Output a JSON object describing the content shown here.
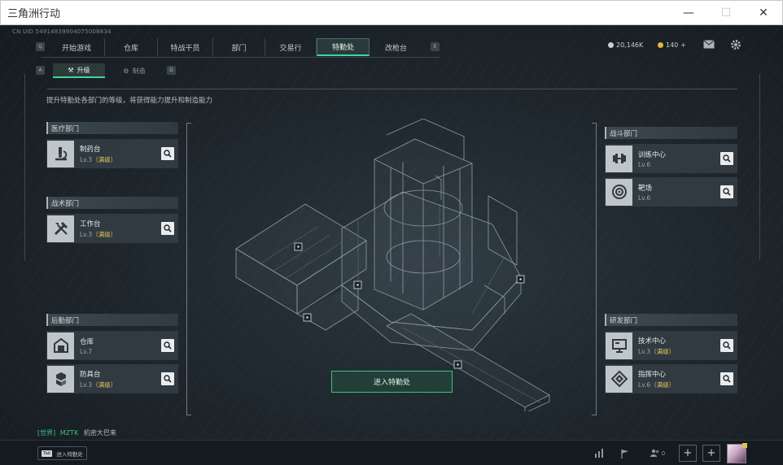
{
  "window": {
    "title": "三角洲行动"
  },
  "uid": "CN UID 549148399040750088​34",
  "nav": {
    "prev_key": "Q",
    "next_key": "E",
    "tabs": [
      {
        "label": "开始游戏"
      },
      {
        "label": "仓库"
      },
      {
        "label": "特战干员"
      },
      {
        "label": "部门"
      },
      {
        "label": "交易行"
      },
      {
        "label": "特勤处",
        "active": true
      },
      {
        "label": "改枪台"
      }
    ]
  },
  "resources": {
    "currency": "20,146K",
    "coupons": "140",
    "coupons_plus": "+"
  },
  "subtabs": {
    "prev_key": "A",
    "next_key": "D",
    "items": [
      {
        "label": "升级",
        "active": true
      },
      {
        "label": "制造"
      }
    ]
  },
  "description": "提升特勤处各部门的等级，将获得能力提升和制造能力",
  "departments": {
    "medical": {
      "title": "医疗部门",
      "items": [
        {
          "name": "制药台",
          "level": "Lv.3",
          "max": "（满级）",
          "icon": "microscope-icon"
        }
      ]
    },
    "tactical": {
      "title": "战术部门",
      "items": [
        {
          "name": "工作台",
          "level": "Lv.3",
          "max": "（满级）",
          "icon": "tools-icon"
        }
      ]
    },
    "logistics": {
      "title": "后勤部门",
      "items": [
        {
          "name": "仓库",
          "level": "Lv.7",
          "icon": "storage-icon"
        },
        {
          "name": "防具台",
          "level": "Lv.3",
          "max": "（满级）",
          "icon": "armor-icon"
        }
      ]
    },
    "combat": {
      "title": "战斗部门",
      "items": [
        {
          "name": "训练中心",
          "level": "Lv.6",
          "icon": "dumbbell-icon"
        },
        {
          "name": "靶场",
          "level": "Lv.6",
          "icon": "target-icon"
        }
      ]
    },
    "research": {
      "title": "研发部门",
      "items": [
        {
          "name": "技术中心",
          "level": "Lv.3",
          "max": "（满级）",
          "icon": "monitor-icon"
        },
        {
          "name": "指挥中心",
          "level": "Lv.6",
          "max": "（满级）",
          "icon": "command-icon"
        }
      ]
    }
  },
  "enter_button": "进入特勤处",
  "chat": {
    "channel": "[世界]",
    "sender": "MZTK",
    "message": "机密大巴来"
  },
  "bottom": {
    "tab_key": "Tab",
    "tab_label": "进入特勤处",
    "friends_count": "0"
  },
  "colors": {
    "accent": "#3fd69b",
    "max_level": "#e2c35b"
  }
}
